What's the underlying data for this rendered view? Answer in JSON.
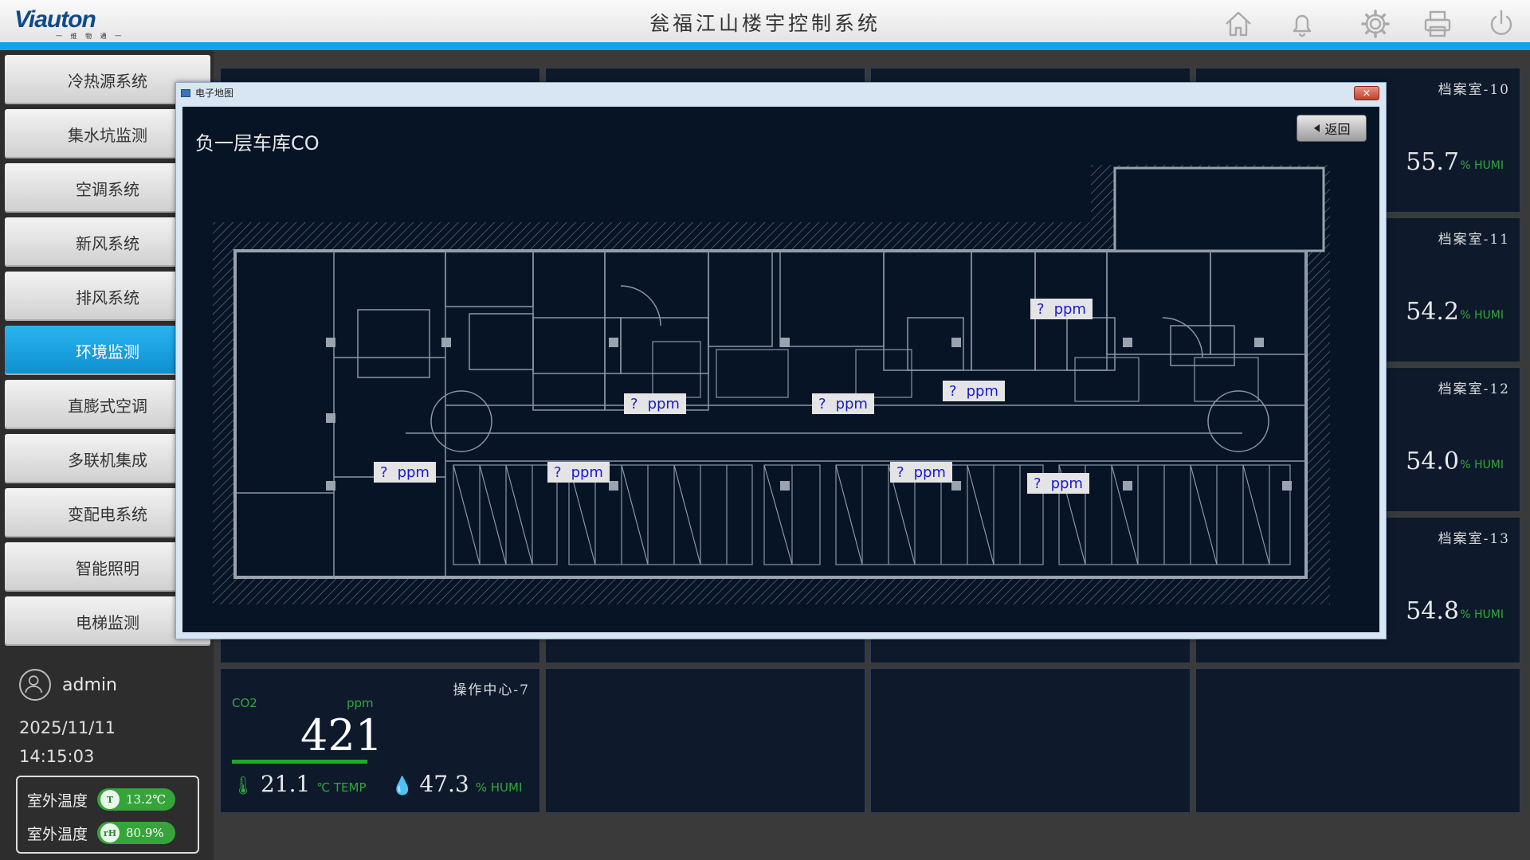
{
  "header": {
    "logo": "Viauton",
    "logo_sub": "一 维 物 通 一",
    "title": "瓮福江山楼宇控制系统",
    "icons": [
      "home-icon",
      "bell-icon",
      "gear-icon",
      "printer-icon",
      "power-icon"
    ]
  },
  "sidebar": {
    "items": [
      {
        "label": "冷热源系统"
      },
      {
        "label": "集水坑监测"
      },
      {
        "label": "空调系统"
      },
      {
        "label": "新风系统"
      },
      {
        "label": "排风系统"
      },
      {
        "label": "环境监测",
        "active": true
      },
      {
        "label": "直膨式空调"
      },
      {
        "label": "多联机集成"
      },
      {
        "label": "变配电系统"
      },
      {
        "label": "智能照明"
      },
      {
        "label": "电梯监测"
      }
    ],
    "user": "admin",
    "date": "2025/11/11",
    "time": "14:15:03",
    "weather": {
      "temp_label": "室外温度",
      "temp_value": "13.2℃",
      "temp_icon": "T",
      "humi_label": "室外温度",
      "humi_value": "80.9%",
      "humi_icon": "rH"
    }
  },
  "cards": {
    "right": [
      {
        "title": "档案室-10",
        "value": "55.7",
        "unit": "% HUMI"
      },
      {
        "title": "档案室-11",
        "value": "54.2",
        "unit": "% HUMI"
      },
      {
        "title": "档案室-12",
        "value": "54.0",
        "unit": "% HUMI"
      },
      {
        "title": "档案室-13",
        "value": "54.8",
        "unit": "% HUMI"
      }
    ],
    "ops": {
      "title": "操作中心-7",
      "co2_label": "CO2",
      "co2_unit": "ppm",
      "co2_value": "421",
      "temp_value": "21.1",
      "temp_unit": "℃ TEMP",
      "humi_value": "47.3",
      "humi_unit": "% HUMI"
    }
  },
  "dialog": {
    "window_title": "电子地图",
    "close_label": "×",
    "map_title": "负一层车库CO",
    "back_label": "返回",
    "sensor_q": "?",
    "sensor_unit": "ppm"
  },
  "colors": {
    "accent": "#14a3e6",
    "active_nav": "#1aa0e4",
    "plan_bg": "#061426",
    "sensor_text": "#1a1acf",
    "reading_green": "#2ea83a"
  }
}
